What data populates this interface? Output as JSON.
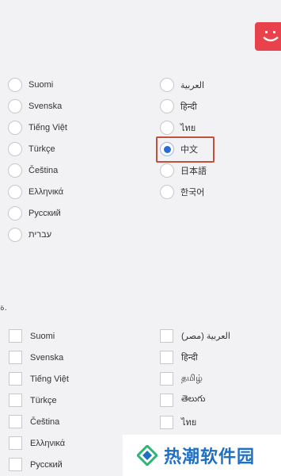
{
  "app_logo": {
    "name": "smiley-logo-icon",
    "color": "#e8424c"
  },
  "language_radio": {
    "left_column": [
      {
        "label": "Suomi",
        "checked": false
      },
      {
        "label": "Svenska",
        "checked": false
      },
      {
        "label": "Tiếng Việt",
        "checked": false
      },
      {
        "label": "Türkçe",
        "checked": false
      },
      {
        "label": "Čeština",
        "checked": false
      },
      {
        "label": "Ελληνικά",
        "checked": false
      },
      {
        "label": "Русский",
        "checked": false
      },
      {
        "label": "עברית",
        "checked": false
      }
    ],
    "right_column": [
      {
        "label": "العربية",
        "checked": false
      },
      {
        "label": "हिन्दी",
        "checked": false
      },
      {
        "label": "ไทย",
        "checked": false
      },
      {
        "label": "中文",
        "checked": true
      },
      {
        "label": "日本語",
        "checked": false
      },
      {
        "label": "한국어",
        "checked": false
      }
    ]
  },
  "section_mark": "ة.",
  "language_checkboxes": {
    "left_column": [
      {
        "label": "Suomi",
        "checked": false
      },
      {
        "label": "Svenska",
        "checked": false
      },
      {
        "label": "Tiếng Việt",
        "checked": false
      },
      {
        "label": "Türkçe",
        "checked": false
      },
      {
        "label": "Čeština",
        "checked": false
      },
      {
        "label": "Ελληνικά",
        "checked": false
      },
      {
        "label": "Русский",
        "checked": false
      }
    ],
    "right_column": [
      {
        "label": "(العربية (مصر",
        "checked": false
      },
      {
        "label": "हिन्दी",
        "checked": false
      },
      {
        "label": "தமிழ்",
        "checked": false
      },
      {
        "label": "తెలుగు",
        "checked": false
      },
      {
        "label": "ไทย",
        "checked": false
      }
    ]
  },
  "watermark": {
    "text": "热潮软件园",
    "color": "#1f6fc2"
  }
}
